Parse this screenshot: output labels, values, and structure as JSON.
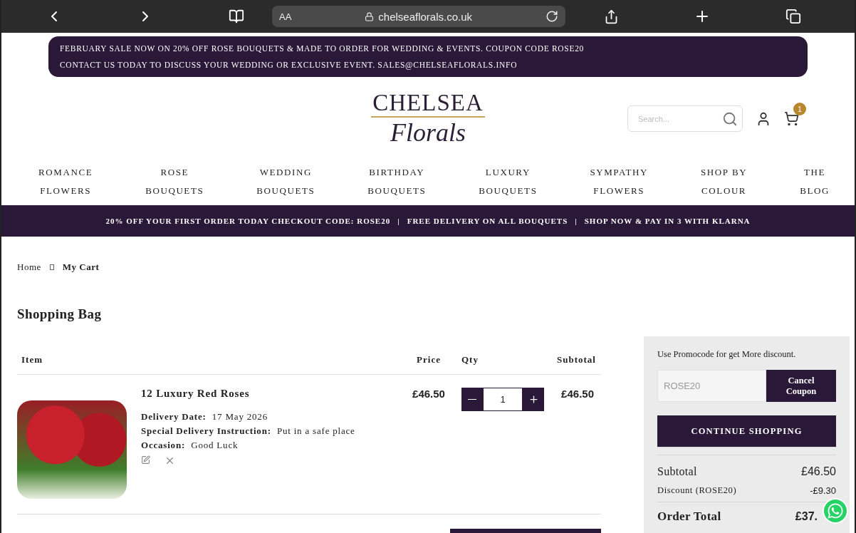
{
  "browser": {
    "text_size": "AA",
    "address": "chelseaflorals.co.uk"
  },
  "announcement": {
    "lines": [
      "FEBRUARY SALE NOW ON 20% OFF ROSE BOUQUETS & MADE TO ORDER FOR WEDDING & EVENTS. COUPON CODE ROSE20",
      "CONTACT US TODAY TO DISCUSS YOUR WEDDING OR EXCLUSIVE EVENT. SALES@CHELSEAFLORALS.INFO"
    ]
  },
  "header": {
    "logo": {
      "line1": "CHELSEA",
      "line2": "Florals"
    },
    "search": {
      "placeholder": "Search..."
    },
    "cart_count": "1"
  },
  "nav": [
    {
      "lines": [
        "ROMANCE",
        "FLOWERS"
      ]
    },
    {
      "lines": [
        "ROSE",
        "BOUQUETS"
      ]
    },
    {
      "lines": [
        "WEDDING",
        "BOUQUETS"
      ]
    },
    {
      "lines": [
        "BIRTHDAY",
        "BOUQUETS"
      ]
    },
    {
      "lines": [
        "LUXURY",
        "BOUQUETS"
      ]
    },
    {
      "lines": [
        "SYMPATHY",
        "FLOWERS"
      ]
    },
    {
      "lines": [
        "SHOP BY",
        "COLOUR"
      ]
    },
    {
      "lines": [
        "THE",
        "BLOG"
      ]
    }
  ],
  "promo_bar": {
    "items": [
      "20% OFF YOUR FIRST ORDER TODAY CHECKOUT CODE: ROSE20",
      "FREE DELIVERY ON ALL BOUQUETS",
      "SHOP NOW & PAY IN 3 WITH KLARNA"
    ],
    "separator": "|"
  },
  "breadcrumb": [
    {
      "label": "Home",
      "selected": false
    },
    {
      "label": "My Cart",
      "selected": true
    }
  ],
  "title": "Shopping Bag",
  "table": {
    "columns": [
      "Item",
      "Price",
      "Qty",
      "Subtotal"
    ],
    "rows": [
      {
        "name": "12 Luxury Red Roses",
        "price": "£46.50",
        "qty": "1",
        "subtotal": "£46.50",
        "details": [
          {
            "label": "Delivery Date:",
            "value": "17 May 2026"
          },
          {
            "label": "Special Delivery Instruction:",
            "value": "Put in a safe place"
          },
          {
            "label": "Occasion:",
            "value": "Good Luck"
          }
        ]
      }
    ]
  },
  "summary": {
    "promo_text": "Use Promocode for get More discount.",
    "coupon_value": "ROSE20",
    "cancel_button": "Cancel Coupon",
    "continue_button": "CONTINUE SHOPPING",
    "lines": [
      {
        "kind": "subtotal",
        "label": "Subtotal",
        "value": "£46.50"
      },
      {
        "kind": "discount",
        "label": "Discount (ROSE20)",
        "value": "-£9.30"
      },
      {
        "kind": "total",
        "label": "Order Total",
        "value": "£37."
      }
    ]
  }
}
